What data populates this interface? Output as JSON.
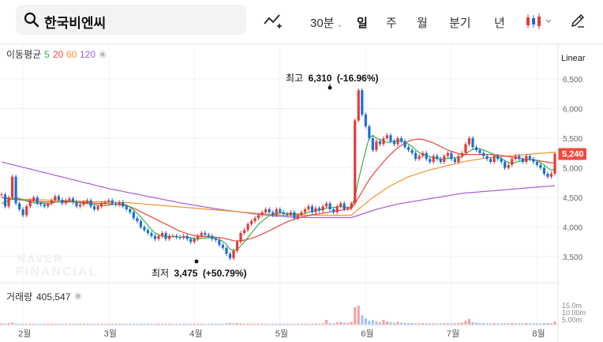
{
  "search": {
    "query": "한국비엔씨"
  },
  "toolbar": {
    "interval_label": "30분",
    "periods": [
      "일",
      "주",
      "월",
      "분기",
      "년"
    ],
    "active_period": "일",
    "icons": [
      "line-draw-icon",
      "candle-type-icon",
      "pencil-icon"
    ]
  },
  "indicator": {
    "label": "이동평균",
    "periods": [
      {
        "value": "5",
        "color": "#3cb043"
      },
      {
        "value": "20",
        "color": "#e8483f"
      },
      {
        "value": "60",
        "color": "#f5922f"
      },
      {
        "value": "120",
        "color": "#a55fd0"
      }
    ]
  },
  "scale_label": "Linear",
  "high_annotation": {
    "label": "최고",
    "value": "6,310",
    "change": "(-16.96%)"
  },
  "low_annotation": {
    "label": "최저",
    "value": "3,475",
    "change": "(+50.79%)"
  },
  "current_price": "5,240",
  "volume": {
    "label": "거래량",
    "value": "405,547",
    "axis_labels": [
      "15.0m",
      "10.00m",
      "5.00m"
    ]
  },
  "watermark": [
    "NAVER",
    "FINANCIAL"
  ],
  "colors": {
    "up": "#e23b3b",
    "down": "#1a6fd8",
    "accent_badge": "#f04a3e"
  },
  "chart_data": {
    "type": "candlestick",
    "y_ticks": [
      3500,
      4000,
      4500,
      5000,
      5500,
      6000,
      6500
    ],
    "ylim": [
      3200,
      6700
    ],
    "x_month_labels": [
      "2월",
      "3월",
      "4월",
      "5월",
      "6월",
      "7월",
      "8월"
    ],
    "grid": true,
    "closes": [
      4550,
      4350,
      4500,
      4850,
      4400,
      4300,
      4200,
      4350,
      4450,
      4500,
      4400,
      4380,
      4350,
      4400,
      4450,
      4520,
      4460,
      4400,
      4450,
      4480,
      4420,
      4350,
      4380,
      4420,
      4450,
      4350,
      4300,
      4350,
      4400,
      4420,
      4450,
      4400,
      4380,
      4420,
      4350,
      4300,
      4250,
      4150,
      4100,
      4000,
      3950,
      3900,
      3850,
      3800,
      3850,
      3900,
      3800,
      3850,
      3850,
      3830,
      3820,
      3850,
      3800,
      3750,
      3800,
      3850,
      3900,
      3870,
      3850,
      3800,
      3780,
      3700,
      3650,
      3550,
      3475,
      3600,
      3750,
      3900,
      3950,
      4050,
      4100,
      4150,
      4200,
      4250,
      4300,
      4250,
      4200,
      4300,
      4250,
      4220,
      4200,
      4250,
      4150,
      4200,
      4250,
      4300,
      4350,
      4250,
      4320,
      4280,
      4350,
      4400,
      4300,
      4250,
      4350,
      4400,
      4300,
      4320,
      4400,
      5800,
      6310,
      5900,
      5700,
      5500,
      5300,
      5450,
      5400,
      5500,
      5550,
      5450,
      5400,
      5500,
      5450,
      5350,
      5300,
      5250,
      5150,
      5200,
      5250,
      5150,
      5100,
      5200,
      5150,
      5100,
      5200,
      5250,
      5150,
      5100,
      5200,
      5250,
      5400,
      5500,
      5350,
      5300,
      5250,
      5200,
      5150,
      5100,
      5200,
      5150,
      5100,
      5000,
      5050,
      5150,
      5200,
      5150,
      5100,
      5200,
      5150,
      5100,
      5050,
      5000,
      4900,
      4850,
      4900,
      5240
    ],
    "ma5": [
      4400,
      4420,
      4450,
      4480,
      4500,
      4480,
      4460,
      4440,
      4420,
      4410,
      4400,
      4410,
      4400,
      4390,
      4400,
      4420,
      4430,
      4430,
      4440,
      4440,
      4430,
      4420,
      4410,
      4400,
      4400,
      4390,
      4380,
      4370,
      4360,
      4360,
      4370,
      4380,
      4390,
      4390,
      4390,
      4370,
      4340,
      4290,
      4230,
      4170,
      4100,
      4030,
      3960,
      3900,
      3870,
      3850,
      3840,
      3840,
      3840,
      3835,
      3830,
      3830,
      3830,
      3820,
      3805,
      3800,
      3810,
      3815,
      3820,
      3815,
      3810,
      3790,
      3760,
      3710,
      3630,
      3600,
      3620,
      3680,
      3750,
      3820,
      3900,
      3970,
      4050,
      4100,
      4150,
      4190,
      4210,
      4230,
      4240,
      4240,
      4230,
      4225,
      4220,
      4220,
      4220,
      4230,
      4250,
      4270,
      4280,
      4290,
      4300,
      4320,
      4330,
      4330,
      4340,
      4350,
      4340,
      4330,
      4340,
      4500,
      4800,
      5050,
      5300,
      5500,
      5550,
      5500,
      5480,
      5450,
      5430,
      5440,
      5450,
      5460,
      5450,
      5430,
      5400,
      5360,
      5300,
      5260,
      5230,
      5210,
      5190,
      5170,
      5160,
      5150,
      5150,
      5160,
      5170,
      5170,
      5170,
      5190,
      5230,
      5280,
      5310,
      5320,
      5320,
      5300,
      5280,
      5250,
      5220,
      5190,
      5160,
      5120,
      5090,
      5080,
      5090,
      5110,
      5120,
      5130,
      5140,
      5140,
      5120,
      5090,
      5050,
      5000,
      4960,
      4980
    ],
    "ma20": [
      4500,
      4490,
      4480,
      4470,
      4465,
      4460,
      4455,
      4450,
      4445,
      4440,
      4435,
      4430,
      4425,
      4425,
      4425,
      4425,
      4425,
      4425,
      4425,
      4425,
      4425,
      4420,
      4420,
      4420,
      4415,
      4410,
      4405,
      4400,
      4400,
      4400,
      4395,
      4390,
      4385,
      4380,
      4370,
      4360,
      4340,
      4320,
      4290,
      4260,
      4230,
      4200,
      4170,
      4140,
      4110,
      4080,
      4050,
      4020,
      3990,
      3960,
      3930,
      3910,
      3890,
      3870,
      3860,
      3850,
      3840,
      3840,
      3840,
      3835,
      3830,
      3825,
      3815,
      3800,
      3785,
      3770,
      3765,
      3770,
      3780,
      3795,
      3810,
      3830,
      3855,
      3880,
      3910,
      3940,
      3970,
      4000,
      4030,
      4060,
      4090,
      4110,
      4130,
      4150,
      4165,
      4180,
      4195,
      4205,
      4215,
      4225,
      4235,
      4245,
      4255,
      4265,
      4275,
      4285,
      4295,
      4305,
      4315,
      4400,
      4500,
      4600,
      4700,
      4800,
      4880,
      4960,
      5030,
      5100,
      5170,
      5230,
      5290,
      5340,
      5380,
      5420,
      5450,
      5470,
      5480,
      5485,
      5480,
      5460,
      5440,
      5420,
      5390,
      5360,
      5330,
      5300,
      5280,
      5260,
      5240,
      5230,
      5225,
      5225,
      5225,
      5225,
      5225,
      5225,
      5225,
      5225,
      5220,
      5215,
      5210,
      5200,
      5190,
      5180,
      5170,
      5160,
      5150,
      5145,
      5140,
      5135,
      5125,
      5115,
      5105,
      5095,
      5085,
      5085
    ],
    "ma60": [
      4500,
      4495,
      4490,
      4485,
      4480,
      4475,
      4470,
      4468,
      4466,
      4464,
      4462,
      4460,
      4458,
      4456,
      4454,
      4452,
      4450,
      4448,
      4446,
      4444,
      4442,
      4440,
      4438,
      4436,
      4434,
      4432,
      4430,
      4428,
      4426,
      4424,
      4422,
      4420,
      4418,
      4416,
      4414,
      4412,
      4408,
      4404,
      4400,
      4395,
      4390,
      4385,
      4380,
      4375,
      4370,
      4365,
      4360,
      4355,
      4350,
      4345,
      4340,
      4335,
      4330,
      4325,
      4320,
      4315,
      4310,
      4305,
      4300,
      4295,
      4290,
      4285,
      4280,
      4275,
      4270,
      4265,
      4260,
      4255,
      4250,
      4245,
      4240,
      4235,
      4230,
      4225,
      4220,
      4215,
      4210,
      4205,
      4200,
      4200,
      4200,
      4200,
      4200,
      4200,
      4200,
      4200,
      4200,
      4200,
      4200,
      4200,
      4200,
      4200,
      4200,
      4200,
      4200,
      4200,
      4200,
      4200,
      4200,
      4250,
      4300,
      4350,
      4400,
      4450,
      4500,
      4540,
      4580,
      4620,
      4660,
      4700,
      4730,
      4760,
      4790,
      4820,
      4850,
      4870,
      4890,
      4910,
      4930,
      4950,
      4965,
      4980,
      4995,
      5010,
      5025,
      5040,
      5055,
      5070,
      5085,
      5100,
      5110,
      5120,
      5130,
      5140,
      5150,
      5160,
      5170,
      5175,
      5180,
      5185,
      5190,
      5195,
      5200,
      5205,
      5210,
      5215,
      5220,
      5225,
      5230,
      5235,
      5240,
      5245,
      5250,
      5255,
      5260,
      5265
    ],
    "ma120": [
      5100,
      5085,
      5070,
      5055,
      5040,
      5025,
      5010,
      4995,
      4980,
      4965,
      4950,
      4935,
      4920,
      4905,
      4890,
      4875,
      4860,
      4845,
      4830,
      4815,
      4800,
      4785,
      4770,
      4755,
      4740,
      4725,
      4710,
      4695,
      4680,
      4665,
      4650,
      4638,
      4626,
      4614,
      4602,
      4590,
      4578,
      4566,
      4554,
      4542,
      4530,
      4518,
      4506,
      4494,
      4482,
      4470,
      4458,
      4446,
      4434,
      4422,
      4410,
      4400,
      4390,
      4380,
      4370,
      4360,
      4350,
      4340,
      4330,
      4320,
      4310,
      4300,
      4292,
      4284,
      4276,
      4268,
      4260,
      4252,
      4244,
      4236,
      4228,
      4220,
      4214,
      4208,
      4202,
      4196,
      4190,
      4186,
      4182,
      4178,
      4174,
      4170,
      4168,
      4166,
      4164,
      4162,
      4160,
      4160,
      4160,
      4160,
      4160,
      4160,
      4160,
      4160,
      4160,
      4160,
      4160,
      4160,
      4160,
      4180,
      4200,
      4220,
      4240,
      4260,
      4280,
      4300,
      4315,
      4330,
      4345,
      4360,
      4375,
      4390,
      4400,
      4410,
      4420,
      4430,
      4440,
      4450,
      4460,
      4470,
      4480,
      4490,
      4500,
      4510,
      4520,
      4530,
      4540,
      4550,
      4560,
      4570,
      4575,
      4580,
      4585,
      4590,
      4595,
      4600,
      4605,
      4610,
      4615,
      4620,
      4625,
      4630,
      4635,
      4640,
      4645,
      4650,
      4655,
      4660,
      4665,
      4670,
      4675,
      4680,
      4685,
      4690,
      4695,
      4700
    ],
    "volume": [
      0.4,
      0.3,
      0.5,
      0.6,
      0.4,
      0.3,
      0.3,
      0.3,
      0.3,
      0.3,
      0.3,
      0.3,
      0.3,
      0.3,
      0.3,
      0.3,
      0.3,
      0.3,
      0.3,
      0.3,
      0.3,
      0.3,
      0.3,
      0.3,
      0.3,
      0.3,
      0.3,
      0.3,
      0.3,
      0.3,
      0.3,
      0.3,
      0.3,
      0.3,
      0.3,
      0.3,
      0.3,
      0.3,
      0.3,
      0.3,
      0.3,
      0.3,
      0.3,
      0.3,
      0.3,
      0.3,
      0.3,
      0.3,
      0.3,
      0.3,
      0.3,
      0.3,
      0.3,
      0.3,
      0.3,
      0.3,
      0.3,
      0.3,
      0.3,
      0.3,
      0.3,
      0.3,
      0.3,
      0.5,
      0.6,
      0.4,
      0.5,
      0.4,
      0.3,
      0.3,
      0.3,
      0.3,
      0.3,
      0.3,
      0.3,
      0.3,
      0.3,
      0.3,
      0.3,
      0.3,
      0.3,
      0.3,
      0.3,
      0.3,
      0.3,
      0.3,
      0.3,
      0.3,
      0.4,
      0.3,
      0.4,
      1.5,
      0.5,
      0.4,
      0.7,
      0.8,
      0.6,
      0.5,
      0.9,
      5.5,
      6.0,
      3.0,
      2.0,
      1.2,
      1.4,
      1.0,
      0.8,
      1.5,
      1.0,
      0.8,
      0.6,
      0.9,
      0.6,
      0.5,
      0.5,
      0.5,
      0.4,
      0.4,
      0.5,
      0.4,
      0.4,
      0.4,
      0.4,
      0.4,
      0.4,
      0.4,
      0.4,
      0.4,
      0.5,
      0.6,
      1.2,
      1.8,
      0.8,
      0.6,
      0.5,
      0.5,
      0.4,
      0.4,
      0.5,
      0.4,
      0.4,
      0.4,
      0.4,
      0.5,
      0.4,
      0.4,
      0.4,
      0.5,
      0.4,
      0.4,
      0.4,
      0.4,
      0.5,
      0.5,
      0.4,
      1.0
    ]
  }
}
